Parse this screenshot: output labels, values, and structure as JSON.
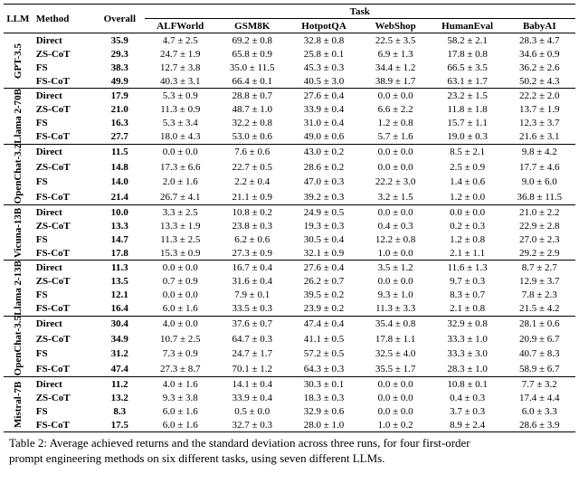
{
  "chart_data": {
    "type": "table",
    "columns": [
      "LLM",
      "Method",
      "Overall",
      "ALFWorld",
      "GSM8K",
      "HotpotQA",
      "WebShop",
      "HumanEval",
      "BabyAI"
    ],
    "groups": [
      {
        "llm": "GPT-3.5",
        "rows": [
          {
            "method": "Direct",
            "overall": "35.9",
            "tasks": [
              "4.7 ± 2.5",
              "69.2 ± 0.8",
              "32.8 ± 0.8",
              "22.5 ± 3.5",
              "58.2 ± 2.1",
              "28.3 ± 4.7"
            ]
          },
          {
            "method": "ZS-CoT",
            "overall": "29.3",
            "tasks": [
              "24.7 ± 1.9",
              "65.8 ± 0.9",
              "25.8 ± 0.1",
              "6.9 ± 1.3",
              "17.8 ± 0.8",
              "34.6 ± 0.9"
            ]
          },
          {
            "method": "FS",
            "overall": "38.3",
            "tasks": [
              "12.7 ± 3.8",
              "35.0 ± 11.5",
              "45.3 ± 0.3",
              "34.4 ± 1.2",
              "66.5 ± 3.5",
              "36.2 ± 2.6"
            ]
          },
          {
            "method": "FS-CoT",
            "overall": "49.9",
            "tasks": [
              "40.3 ± 3.1",
              "66.4 ± 0.1",
              "40.5 ± 3.0",
              "38.9 ± 1.7",
              "63.1 ± 1.7",
              "50.2 ± 4.3"
            ]
          }
        ]
      },
      {
        "llm": "Llama 2-70B",
        "rows": [
          {
            "method": "Direct",
            "overall": "17.9",
            "tasks": [
              "5.3 ± 0.9",
              "28.8 ± 0.7",
              "27.6 ± 0.4",
              "0.0 ± 0.0",
              "23.2 ± 1.5",
              "22.2 ± 2.0"
            ]
          },
          {
            "method": "ZS-CoT",
            "overall": "21.0",
            "tasks": [
              "11.3 ± 0.9",
              "48.7 ± 1.0",
              "33.9 ± 0.4",
              "6.6 ± 2.2",
              "11.8 ± 1.8",
              "13.7 ± 1.9"
            ]
          },
          {
            "method": "FS",
            "overall": "16.3",
            "tasks": [
              "5.3 ± 3.4",
              "32.2 ± 0.8",
              "31.0 ± 0.4",
              "1.2 ± 0.8",
              "15.7 ± 1.1",
              "12.3 ± 3.7"
            ]
          },
          {
            "method": "FS-CoT",
            "overall": "27.7",
            "tasks": [
              "18.0 ± 4.3",
              "53.0 ± 0.6",
              "49.0 ± 0.6",
              "5.7 ± 1.6",
              "19.0 ± 0.3",
              "21.6 ± 3.1"
            ]
          }
        ]
      },
      {
        "llm": "OpenChat-3.2",
        "rows": [
          {
            "method": "Direct",
            "overall": "11.5",
            "tasks": [
              "0.0 ± 0.0",
              "7.6 ± 0.6",
              "43.0 ± 0.2",
              "0.0 ± 0.0",
              "8.5 ± 2.1",
              "9.8 ± 4.2"
            ]
          },
          {
            "method": "ZS-CoT",
            "overall": "14.8",
            "tasks": [
              "17.3 ± 6.6",
              "22.7 ± 0.5",
              "28.6 ± 0.2",
              "0.0 ± 0.0",
              "2.5 ± 0.9",
              "17.7 ± 4.6"
            ]
          },
          {
            "method": "FS",
            "overall": "14.0",
            "tasks": [
              "2.0 ± 1.6",
              "2.2 ± 0.4",
              "47.0 ± 0.3",
              "22.2 ± 3.0",
              "1.4 ± 0.6",
              "9.0 ± 6.0"
            ]
          },
          {
            "method": "FS-CoT",
            "overall": "21.4",
            "tasks": [
              "26.7 ± 4.1",
              "21.1 ± 0.9",
              "39.2 ± 0.3",
              "3.2 ± 1.5",
              "1.2 ± 0.0",
              "36.8 ± 11.5"
            ]
          }
        ]
      },
      {
        "llm": "Vicuna-13B",
        "rows": [
          {
            "method": "Direct",
            "overall": "10.0",
            "tasks": [
              "3.3 ± 2.5",
              "10.8 ± 0.2",
              "24.9 ± 0.5",
              "0.0 ± 0.0",
              "0.0 ± 0.0",
              "21.0 ± 2.2"
            ]
          },
          {
            "method": "ZS-CoT",
            "overall": "13.3",
            "tasks": [
              "13.3 ± 1.9",
              "23.8 ± 0.3",
              "19.3 ± 0.3",
              "0.4 ± 0.3",
              "0.2 ± 0.3",
              "22.9 ± 2.8"
            ]
          },
          {
            "method": "FS",
            "overall": "14.7",
            "tasks": [
              "11.3 ± 2.5",
              "6.2 ± 0.6",
              "30.5 ± 0.4",
              "12.2 ± 0.8",
              "1.2 ± 0.8",
              "27.0 ± 2.3"
            ]
          },
          {
            "method": "FS-CoT",
            "overall": "17.8",
            "tasks": [
              "15.3 ± 0.9",
              "27.3 ± 0.9",
              "32.1 ± 0.9",
              "1.0 ± 0.0",
              "2.1 ± 1.1",
              "29.2 ± 2.9"
            ]
          }
        ]
      },
      {
        "llm": "Llama 2-13B",
        "rows": [
          {
            "method": "Direct",
            "overall": "11.3",
            "tasks": [
              "0.0 ± 0.0",
              "16.7 ± 0.4",
              "27.6 ± 0.4",
              "3.5 ± 1.2",
              "11.6 ± 1.3",
              "8.7 ± 2.7"
            ]
          },
          {
            "method": "ZS-CoT",
            "overall": "13.5",
            "tasks": [
              "0.7 ± 0.9",
              "31.6 ± 0.4",
              "26.2 ± 0.7",
              "0.0 ± 0.0",
              "9.7 ± 0.3",
              "12.9 ± 3.7"
            ]
          },
          {
            "method": "FS",
            "overall": "12.1",
            "tasks": [
              "0.0 ± 0.0",
              "7.9 ± 0.1",
              "39.5 ± 0.2",
              "9.3 ± 1.0",
              "8.3 ± 0.7",
              "7.8 ± 2.3"
            ]
          },
          {
            "method": "FS-CoT",
            "overall": "16.4",
            "tasks": [
              "6.0 ± 1.6",
              "33.5 ± 0.3",
              "23.9 ± 0.2",
              "11.3 ± 3.3",
              "2.1 ± 0.8",
              "21.5 ± 4.2"
            ]
          }
        ]
      },
      {
        "llm": "OpenChat-3.5",
        "rows": [
          {
            "method": "Direct",
            "overall": "30.4",
            "tasks": [
              "4.0 ± 0.0",
              "37.6 ± 0.7",
              "47.4 ± 0.4",
              "35.4 ± 0.8",
              "32.9 ± 0.8",
              "28.1 ± 0.6"
            ]
          },
          {
            "method": "ZS-CoT",
            "overall": "34.9",
            "tasks": [
              "10.7 ± 2.5",
              "64.7 ± 0.3",
              "41.1 ± 0.5",
              "17.8 ± 1.1",
              "33.3 ± 1.0",
              "20.9 ± 6.7"
            ]
          },
          {
            "method": "FS",
            "overall": "31.2",
            "tasks": [
              "7.3 ± 0.9",
              "24.7 ± 1.7",
              "57.2 ± 0.5",
              "32.5 ± 4.0",
              "33.3 ± 3.0",
              "40.7 ± 8.3"
            ]
          },
          {
            "method": "FS-CoT",
            "overall": "47.4",
            "tasks": [
              "27.3 ± 8.7",
              "70.1 ± 1.2",
              "64.3 ± 0.3",
              "35.5 ± 1.7",
              "28.3 ± 1.0",
              "58.9 ± 6.7"
            ]
          }
        ]
      },
      {
        "llm": "Mistral-7B",
        "rows": [
          {
            "method": "Direct",
            "overall": "11.2",
            "tasks": [
              "4.0 ± 1.6",
              "14.1 ± 0.4",
              "30.3 ± 0.1",
              "0.0 ± 0.0",
              "10.8 ± 0.1",
              "7.7 ± 3.2"
            ]
          },
          {
            "method": "ZS-CoT",
            "overall": "13.2",
            "tasks": [
              "9.3 ± 3.8",
              "33.9 ± 0.4",
              "18.3 ± 0.3",
              "0.0 ± 0.0",
              "0.4 ± 0.3",
              "17.4 ± 4.4"
            ]
          },
          {
            "method": "FS",
            "overall": "8.3",
            "tasks": [
              "6.0 ± 1.6",
              "0.5 ± 0.0",
              "32.9 ± 0.6",
              "0.0 ± 0.0",
              "3.7 ± 0.3",
              "6.0 ± 3.3"
            ]
          },
          {
            "method": "FS-CoT",
            "overall": "17.5",
            "tasks": [
              "6.0 ± 1.6",
              "32.7 ± 0.3",
              "28.0 ± 1.0",
              "1.0 ± 0.2",
              "8.9 ± 2.4",
              "28.6 ± 3.9"
            ]
          }
        ]
      }
    ]
  },
  "header": {
    "llm": "LLM",
    "method": "Method",
    "overall": "Overall",
    "task": "Task",
    "tasks": [
      "ALFWorld",
      "GSM8K",
      "HotpotQA",
      "WebShop",
      "HumanEval",
      "BabyAI"
    ]
  },
  "caption": {
    "line1": "Table 2: Average achieved returns and the standard deviation across three runs, for four first-order",
    "line2": "prompt engineering methods on six different tasks, using seven different LLMs."
  }
}
